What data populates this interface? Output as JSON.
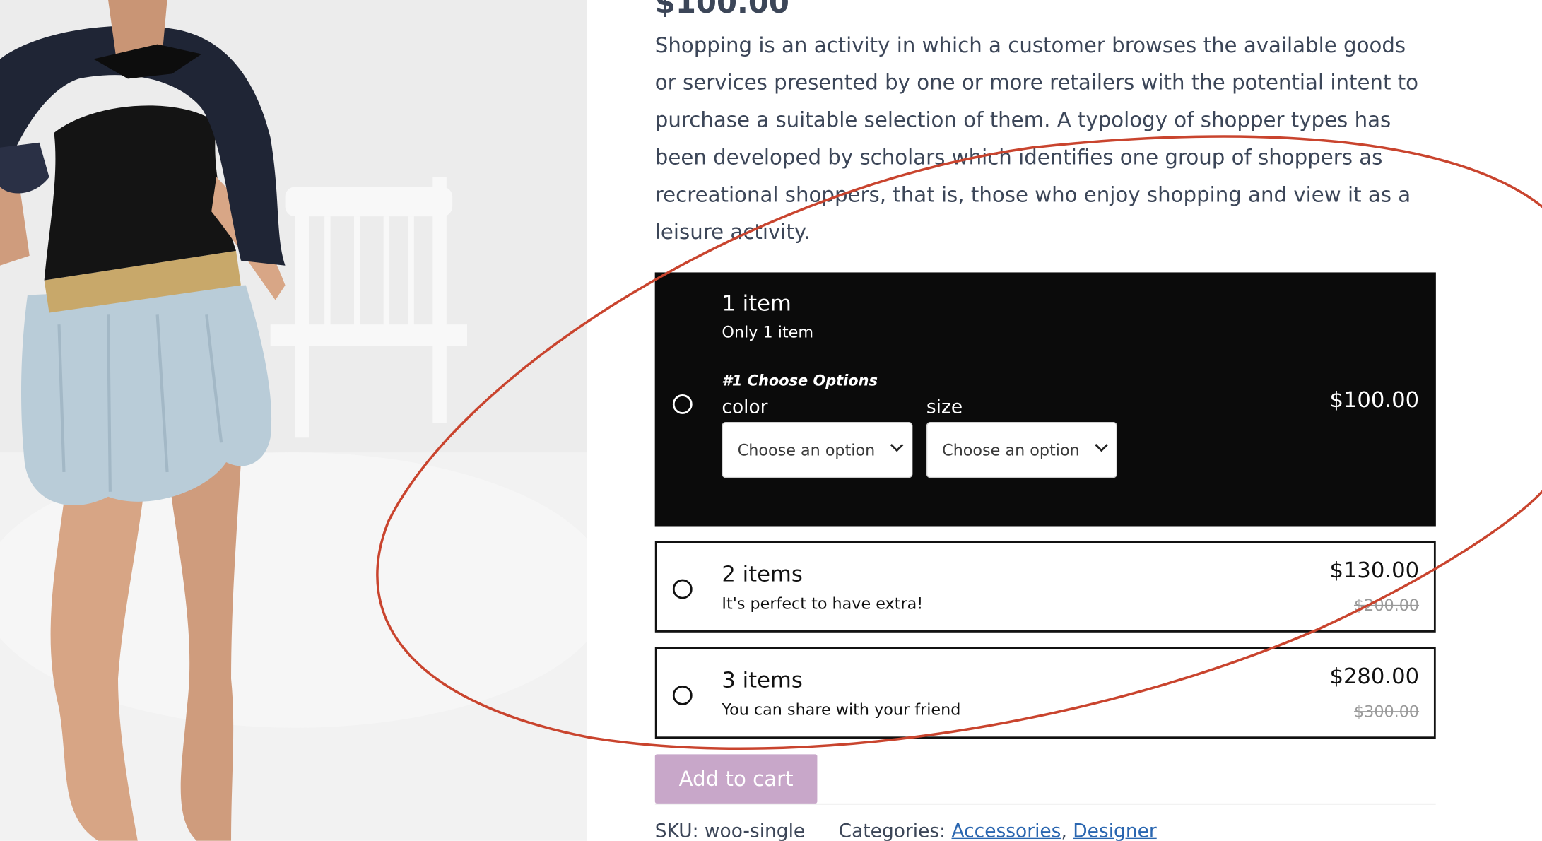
{
  "product": {
    "price": "$100.00",
    "description": "Shopping is an activity in which a customer browses the available goods or services presented by one or more retailers with the potential intent to purchase a suitable selection of them. A typology of shopper types has been developed by scholars which identifies one group of shoppers as recreational shoppers, that is, those who enjoy shopping and view it as a leisure activity."
  },
  "options": [
    {
      "title": "1 item",
      "subtitle": "Only 1 item",
      "price": "$100.00",
      "selected": true,
      "choose_heading": "#1 Choose Options",
      "color_label": "color",
      "size_label": "size",
      "color_value": "Choose an option",
      "size_value": "Choose an option"
    },
    {
      "title": "2 items",
      "subtitle": "It's perfect to have extra!",
      "price": "$130.00",
      "old_price": "$200.00"
    },
    {
      "title": "3 items",
      "subtitle": "You can share with your friend",
      "price": "$280.00",
      "old_price": "$300.00"
    }
  ],
  "actions": {
    "add_to_cart": "Add to cart"
  },
  "meta": {
    "sku_label": "SKU:",
    "sku_value": "woo-single",
    "categories_label": "Categories:",
    "categories": [
      "Accessories",
      "Designer"
    ],
    "separator": ", "
  },
  "icons": {
    "radio": "radio-icon",
    "chevron": "chevron-down-icon"
  },
  "colors": {
    "selected_background": "#0b0b0b",
    "add_to_cart": "#c8a7c9",
    "link": "#2a66b0",
    "annotation": "#c9442e"
  }
}
